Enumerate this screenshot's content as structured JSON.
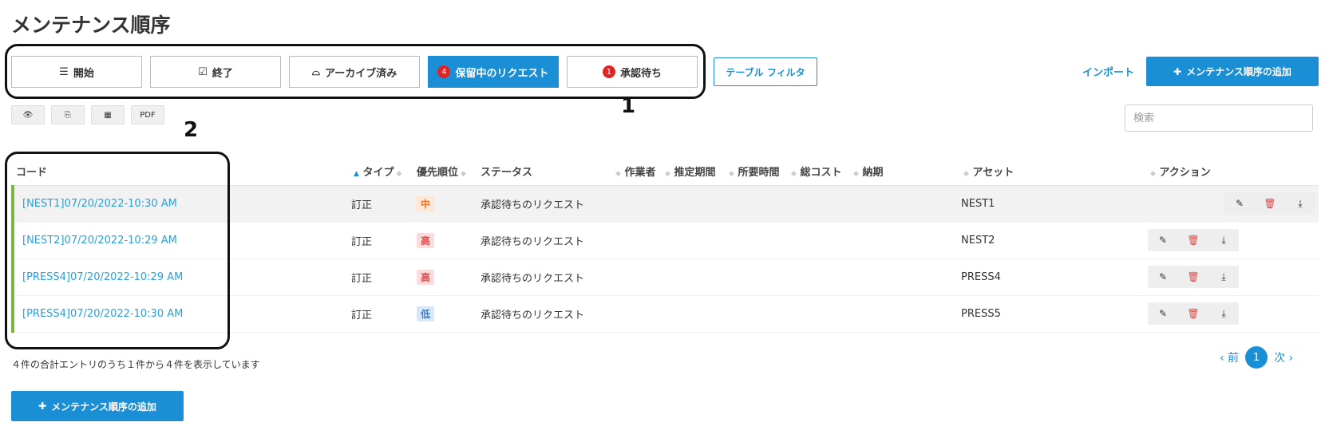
{
  "page": {
    "title": "メンテナンス順序"
  },
  "tabs": [
    {
      "icon": "list-icon",
      "glyph": "☰",
      "label": "開始",
      "badge": ""
    },
    {
      "icon": "check-square-icon",
      "glyph": "☑",
      "label": "終了",
      "badge": ""
    },
    {
      "icon": "inbox-icon",
      "glyph": "⌓",
      "label": "アーカイブ済み",
      "badge": ""
    },
    {
      "icon": "",
      "glyph": "",
      "label": "保留中のリクエスト",
      "badge": "4"
    },
    {
      "icon": "",
      "glyph": "",
      "label": "承認待ち",
      "badge": "1"
    }
  ],
  "filter_button": "テーブル フィルタ",
  "import_link": "インポート",
  "add_button": "メンテナンス順序の追加",
  "tools": {
    "view": "👁",
    "copy": "⎘",
    "grid": "▦",
    "pdf": "PDF"
  },
  "search": {
    "placeholder": "検索"
  },
  "callouts": {
    "one": "1",
    "two": "2"
  },
  "table": {
    "headers": {
      "code": "コード",
      "type": "タイプ",
      "priority": "優先順位",
      "status": "ステータス",
      "worker": "作業者",
      "estimate": "推定期間",
      "duration": "所要時間",
      "cost": "総コスト",
      "due": "納期",
      "asset": "アセット",
      "action": "アクション"
    },
    "rows": [
      {
        "code": "[NEST1]07/20/2022-10:30 AM",
        "type": "訂正",
        "priority": "中",
        "priority_level": "mid",
        "status": "承認待ちのリクエスト",
        "asset": "NEST1"
      },
      {
        "code": "[NEST2]07/20/2022-10:29 AM",
        "type": "訂正",
        "priority": "高",
        "priority_level": "high",
        "status": "承認待ちのリクエスト",
        "asset": "NEST2"
      },
      {
        "code": "[PRESS4]07/20/2022-10:29 AM",
        "type": "訂正",
        "priority": "高",
        "priority_level": "high",
        "status": "承認待ちのリクエスト",
        "asset": "PRESS4"
      },
      {
        "code": "[PRESS4]07/20/2022-10:30 AM",
        "type": "訂正",
        "priority": "低",
        "priority_level": "low",
        "status": "承認待ちのリクエスト",
        "asset": "PRESS5"
      }
    ]
  },
  "footer": {
    "info": "４件の合計エントリのうち１件から４件を表示しています",
    "prev": "‹ 前",
    "page": "1",
    "next": "次 ›"
  },
  "colors": {
    "accent": "#1a8fd6",
    "row_marker": "#7cb342",
    "badge": "#e02424"
  }
}
